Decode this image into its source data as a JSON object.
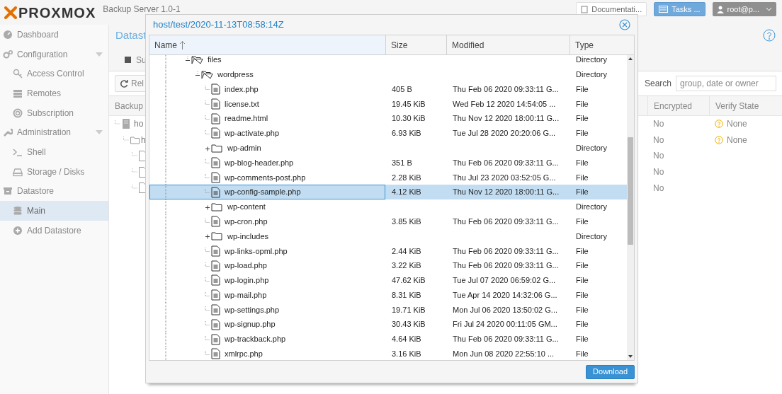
{
  "header": {
    "logo": "PROXMOX",
    "product": "Backup Server 1.0-1",
    "buttons": [
      {
        "kind": "docs",
        "label": "Documentati..."
      },
      {
        "kind": "tasks",
        "label": "Tasks ..."
      },
      {
        "kind": "user",
        "label": "root@p..."
      }
    ]
  },
  "sidebar": {
    "items": [
      {
        "label": "Dashboard",
        "selected": false
      },
      {
        "label": "Configuration",
        "selected": false,
        "expanded": true,
        "children": [
          {
            "label": "Access Control",
            "selected": false
          },
          {
            "label": "Remotes",
            "selected": false
          },
          {
            "label": "Subscription",
            "selected": false
          }
        ]
      },
      {
        "label": "Administration",
        "selected": false,
        "expanded": true,
        "children": [
          {
            "label": "Shell",
            "selected": false
          },
          {
            "label": "Storage / Disks",
            "selected": false
          }
        ]
      },
      {
        "label": "Datastore",
        "selected": false,
        "children": [
          {
            "label": "Main",
            "selected": true
          },
          {
            "label": "Add Datastore",
            "selected": false
          }
        ]
      }
    ]
  },
  "content": {
    "title": "Datast",
    "tab": "Su",
    "reload": "Rel",
    "search_label": "Search",
    "search_placeholder": "group, date or owner",
    "columns": [
      "Backup",
      "Encrypted",
      "Verify State"
    ],
    "tree": [
      {
        "kind": "group",
        "label": "ho",
        "children": [
          {
            "kind": "snapshot",
            "label": "h",
            "children": [
              {
                "kind": "file"
              },
              {
                "kind": "file"
              },
              {
                "kind": "file"
              }
            ]
          }
        ]
      }
    ],
    "rows": [
      {
        "encrypted": "No",
        "verify": "None"
      },
      {
        "encrypted": "No",
        "verify": "None"
      },
      {
        "encrypted": "No"
      },
      {
        "encrypted": "No"
      },
      {
        "encrypted": "No"
      }
    ]
  },
  "dialog": {
    "title": "host/test/2020-11-13T08:58:14Z",
    "columns": [
      {
        "label": "Name",
        "sorted": true
      },
      {
        "label": "Size",
        "sorted": false
      },
      {
        "label": "Modified",
        "sorted": false
      },
      {
        "label": "Type",
        "sorted": false
      }
    ],
    "tree": [
      {
        "kind": "dir",
        "name": "files",
        "type": "Directory",
        "expanded": true,
        "selected": false,
        "children": [
          {
            "kind": "dir",
            "name": "wordpress",
            "type": "Directory",
            "expanded": true,
            "selected": false,
            "children": [
              {
                "kind": "file",
                "name": "index.php",
                "size": "405 B",
                "modified": "Thu Feb 06 2020 09:33:11 G...",
                "type": "File",
                "selected": false
              },
              {
                "kind": "file",
                "name": "license.txt",
                "size": "19.45 KiB",
                "modified": "Wed Feb 12 2020 14:54:05 ...",
                "type": "File",
                "selected": false
              },
              {
                "kind": "file",
                "name": "readme.html",
                "size": "10.30 KiB",
                "modified": "Thu Nov 12 2020 18:00:11 G...",
                "type": "File",
                "selected": false
              },
              {
                "kind": "file",
                "name": "wp-activate.php",
                "size": "6.93 KiB",
                "modified": "Tue Jul 28 2020 20:20:06 G...",
                "type": "File",
                "selected": false
              },
              {
                "kind": "dir",
                "name": "wp-admin",
                "type": "Directory",
                "expanded": false,
                "selected": false
              },
              {
                "kind": "file",
                "name": "wp-blog-header.php",
                "size": "351 B",
                "modified": "Thu Feb 06 2020 09:33:11 G...",
                "type": "File",
                "selected": false
              },
              {
                "kind": "file",
                "name": "wp-comments-post.php",
                "size": "2.28 KiB",
                "modified": "Thu Jul 23 2020 03:52:05 G...",
                "type": "File",
                "selected": false
              },
              {
                "kind": "file",
                "name": "wp-config-sample.php",
                "size": "4.12 KiB",
                "modified": "Thu Nov 12 2020 18:00:11 G...",
                "type": "File",
                "selected": true
              },
              {
                "kind": "dir",
                "name": "wp-content",
                "type": "Directory",
                "expanded": false,
                "selected": false
              },
              {
                "kind": "file",
                "name": "wp-cron.php",
                "size": "3.85 KiB",
                "modified": "Thu Feb 06 2020 09:33:11 G...",
                "type": "File",
                "selected": false
              },
              {
                "kind": "dir",
                "name": "wp-includes",
                "type": "Directory",
                "expanded": false,
                "selected": false
              },
              {
                "kind": "file",
                "name": "wp-links-opml.php",
                "size": "2.44 KiB",
                "modified": "Thu Feb 06 2020 09:33:11 G...",
                "type": "File",
                "selected": false
              },
              {
                "kind": "file",
                "name": "wp-load.php",
                "size": "3.22 KiB",
                "modified": "Thu Feb 06 2020 09:33:11 G...",
                "type": "File",
                "selected": false
              },
              {
                "kind": "file",
                "name": "wp-login.php",
                "size": "47.62 KiB",
                "modified": "Tue Jul 07 2020 06:59:02 G...",
                "type": "File",
                "selected": false
              },
              {
                "kind": "file",
                "name": "wp-mail.php",
                "size": "8.31 KiB",
                "modified": "Tue Apr 14 2020 14:32:06 G...",
                "type": "File",
                "selected": false
              },
              {
                "kind": "file",
                "name": "wp-settings.php",
                "size": "19.71 KiB",
                "modified": "Mon Jul 06 2020 13:50:02 G...",
                "type": "File",
                "selected": false
              },
              {
                "kind": "file",
                "name": "wp-signup.php",
                "size": "30.43 KiB",
                "modified": "Fri Jul 24 2020 00:11:05 GM...",
                "type": "File",
                "selected": false
              },
              {
                "kind": "file",
                "name": "wp-trackback.php",
                "size": "4.64 KiB",
                "modified": "Thu Feb 06 2020 09:33:11 G...",
                "type": "File",
                "selected": false
              },
              {
                "kind": "file",
                "name": "xmlrpc.php",
                "size": "3.16 KiB",
                "modified": "Mon Jun 08 2020 22:55:10 ...",
                "type": "File",
                "selected": false
              }
            ]
          }
        ]
      }
    ],
    "download": "Download"
  }
}
